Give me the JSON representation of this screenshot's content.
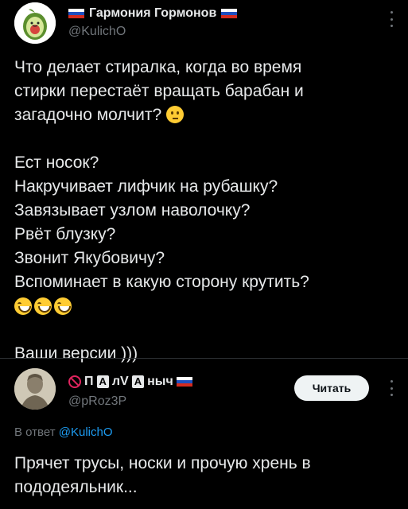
{
  "post": {
    "author_name": "Гармония Гормонов",
    "author_handle": "@KulichO",
    "lines_1": "Что делает стиралка, когда во время\nстирки перестаёт вращать барабан и\nзагадочно молчит?",
    "lines_2": "Ест носок?\nНакручивает лифчик на рубашку?\nЗавязывает узлом наволочку?\nРвёт блузку?\nЗвонит Якубовичу?\nВспоминает в какую сторону крутить?",
    "closing": "Ваши версии )))",
    "emoji_think": "thinking-face-icon",
    "emoji_laugh": "grinning-squinting-face-icon"
  },
  "reply": {
    "name_a": "П",
    "name_b": "А",
    "name_c": "лV",
    "name_d": "А",
    "name_e": "ныч",
    "handle": "@pRoz3P",
    "follow_label": "Читать",
    "reply_to_label": "В ответ",
    "reply_to_mention": "@KulichO",
    "text": "Прячет трусы, носки и прочую  хрень в пододеяльник..."
  },
  "colors": {
    "background": "#000000",
    "text": "#e7e9ea",
    "secondary": "#71767b",
    "link": "#1d9bf0",
    "divider": "#2f3336"
  }
}
